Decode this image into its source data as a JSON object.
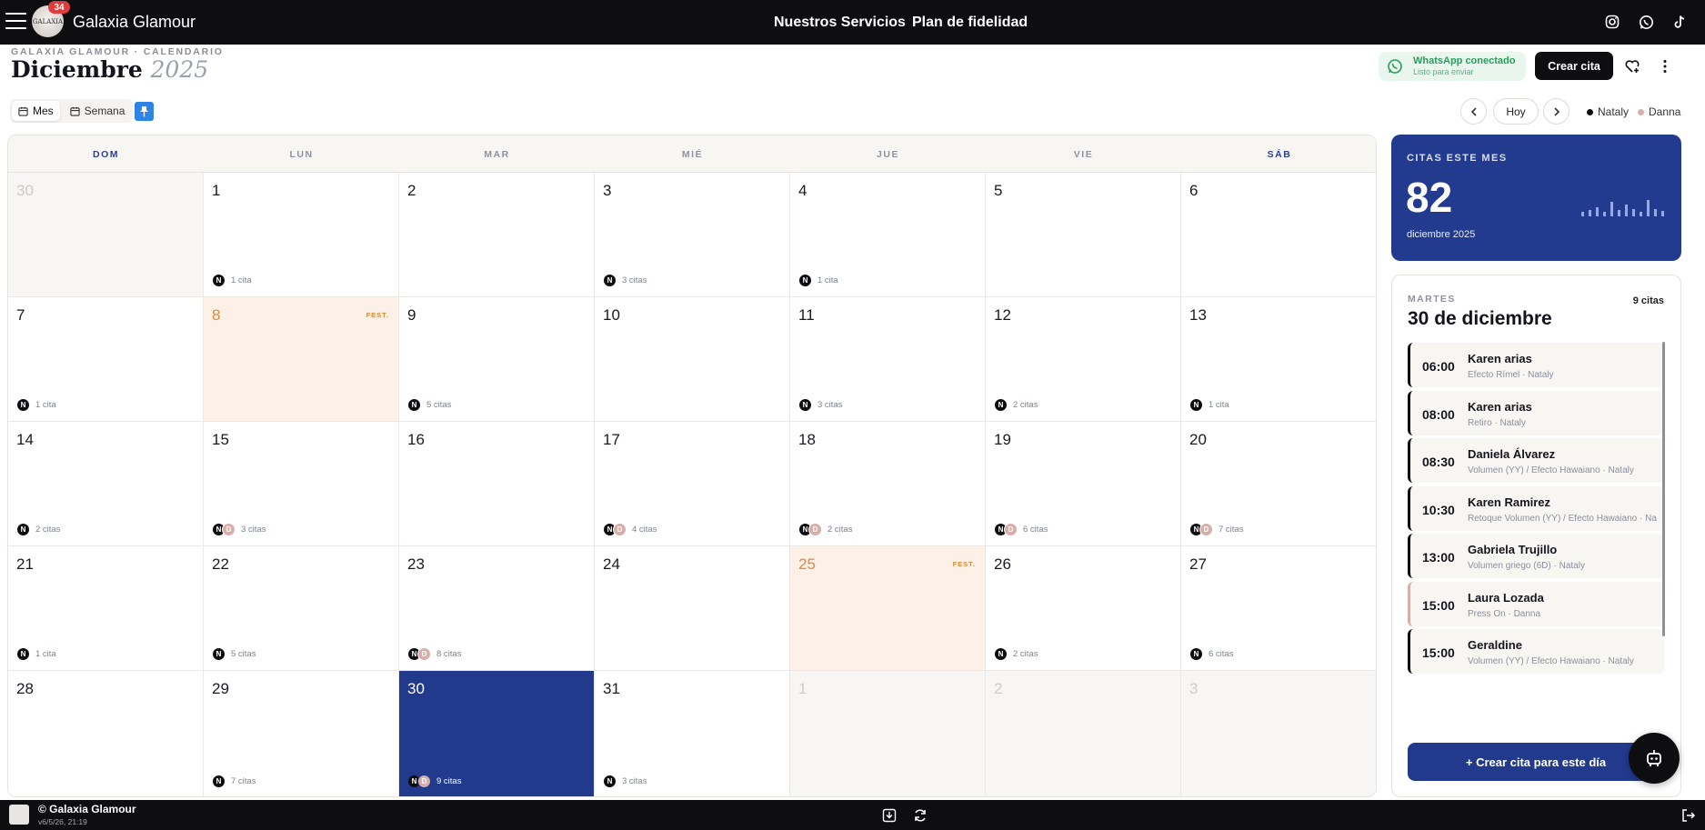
{
  "topbar": {
    "brand": "Galaxia Glamour",
    "logo_text": "GALAXIA",
    "notification_count": "34",
    "nav": [
      "Nuestros Servicios",
      "Plan de fidelidad"
    ],
    "icons": [
      "instagram-icon",
      "whatsapp-icon",
      "tiktok-icon"
    ]
  },
  "header": {
    "eyebrow": "GALAXIA GLAMOUR · CALENDARIO",
    "month": "Diciembre",
    "year": "2025",
    "whatsapp": {
      "title": "WhatsApp conectado",
      "subtitle": "Listo para enviar"
    },
    "create_label": "Crear cita"
  },
  "toolbar": {
    "views": [
      "Mes",
      "Semana"
    ],
    "today_label": "Hoy",
    "legend": [
      {
        "name": "Nataly",
        "color": "#0e0e10"
      },
      {
        "name": "Danna",
        "color": "#d7aeaa"
      }
    ]
  },
  "calendar": {
    "weekdays": [
      "DOM",
      "LUN",
      "MAR",
      "MIÉ",
      "JUE",
      "VIE",
      "SÁB"
    ],
    "holiday_label": "FEST.",
    "days": [
      {
        "d": "30",
        "muted": true
      },
      {
        "d": "1",
        "appts": "1 cita",
        "av": [
          "N"
        ]
      },
      {
        "d": "2"
      },
      {
        "d": "3",
        "appts": "3 citas",
        "av": [
          "N"
        ]
      },
      {
        "d": "4",
        "appts": "1 cita",
        "av": [
          "N"
        ]
      },
      {
        "d": "5"
      },
      {
        "d": "6"
      },
      {
        "d": "7",
        "appts": "1 cita",
        "av": [
          "N"
        ]
      },
      {
        "d": "8",
        "holiday": true
      },
      {
        "d": "9",
        "appts": "5 citas",
        "av": [
          "N"
        ]
      },
      {
        "d": "10"
      },
      {
        "d": "11",
        "appts": "3 citas",
        "av": [
          "N"
        ]
      },
      {
        "d": "12",
        "appts": "2 citas",
        "av": [
          "N"
        ]
      },
      {
        "d": "13",
        "appts": "1 cita",
        "av": [
          "N"
        ]
      },
      {
        "d": "14",
        "appts": "2 citas",
        "av": [
          "N"
        ]
      },
      {
        "d": "15",
        "appts": "3 citas",
        "av": [
          "N",
          "D"
        ]
      },
      {
        "d": "16"
      },
      {
        "d": "17",
        "appts": "4 citas",
        "av": [
          "N",
          "D"
        ]
      },
      {
        "d": "18",
        "appts": "2 citas",
        "av": [
          "N",
          "D"
        ]
      },
      {
        "d": "19",
        "appts": "6 citas",
        "av": [
          "N",
          "D"
        ]
      },
      {
        "d": "20",
        "appts": "7 citas",
        "av": [
          "N",
          "D"
        ]
      },
      {
        "d": "21",
        "appts": "1 cita",
        "av": [
          "N"
        ]
      },
      {
        "d": "22",
        "appts": "5 citas",
        "av": [
          "N"
        ]
      },
      {
        "d": "23",
        "appts": "8 citas",
        "av": [
          "N",
          "D"
        ]
      },
      {
        "d": "24"
      },
      {
        "d": "25",
        "holiday": true
      },
      {
        "d": "26",
        "appts": "2 citas",
        "av": [
          "N"
        ]
      },
      {
        "d": "27",
        "appts": "6 citas",
        "av": [
          "N"
        ]
      },
      {
        "d": "28"
      },
      {
        "d": "29",
        "appts": "7 citas",
        "av": [
          "N"
        ]
      },
      {
        "d": "30",
        "appts": "9 citas",
        "av": [
          "N",
          "D"
        ],
        "selected": true
      },
      {
        "d": "31",
        "appts": "3 citas",
        "av": [
          "N"
        ]
      },
      {
        "d": "1",
        "muted": true
      },
      {
        "d": "2",
        "muted": true
      },
      {
        "d": "3",
        "muted": true
      }
    ]
  },
  "stats": {
    "label": "CITAS ESTE MES",
    "value": "82",
    "subtitle": "diciembre 2025"
  },
  "day_panel": {
    "weekday": "MARTES",
    "count": "9 citas",
    "date": "30 de diciembre",
    "appointments": [
      {
        "time": "06:00",
        "name": "Karen arias",
        "detail": "Efecto Rímel · Nataly",
        "staff": "Nataly"
      },
      {
        "time": "08:00",
        "name": "Karen arias",
        "detail": "Retiro · Nataly",
        "staff": "Nataly"
      },
      {
        "time": "08:30",
        "name": "Daniela Álvarez",
        "detail": "Volumen (YY) / Efecto Hawaiano · Nataly",
        "staff": "Nataly"
      },
      {
        "time": "10:30",
        "name": "Karen Ramirez",
        "detail": "Retoque Volumen (YY) / Efecto Hawaiano · Na",
        "staff": "Nataly"
      },
      {
        "time": "13:00",
        "name": "Gabriela Trujillo",
        "detail": "Volumen griego (6D) · Nataly",
        "staff": "Nataly"
      },
      {
        "time": "15:00",
        "name": "Laura Lozada",
        "detail": "Press On · Danna",
        "staff": "Danna"
      },
      {
        "time": "15:00",
        "name": "Geraldine",
        "detail": "Volumen (YY) / Efecto Hawaiano · Nataly",
        "staff": "Nataly"
      }
    ],
    "create_label": "+ Crear cita para este día"
  },
  "footer": {
    "title": "© Galaxia Glamour",
    "version": "v6/5/26, 21:19"
  }
}
